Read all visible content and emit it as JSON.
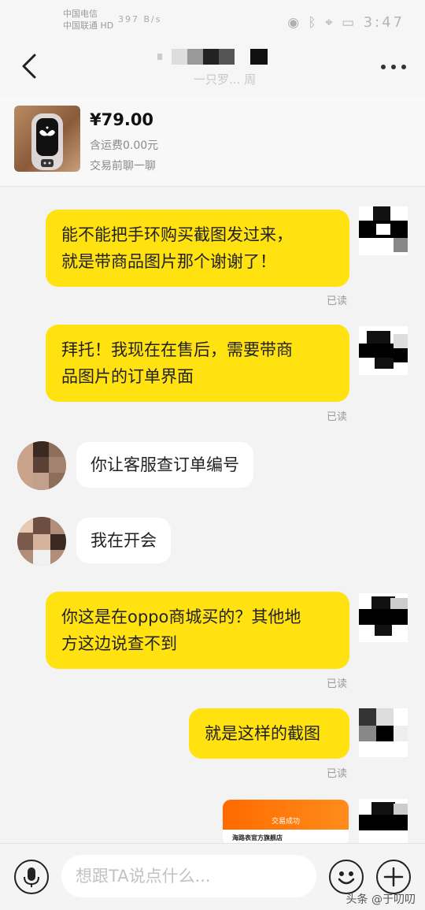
{
  "status_bar": {
    "carrier_line1": "中国电信",
    "carrier_line2": "中国联通 HD",
    "network": "397 B/s",
    "time": "3:47"
  },
  "nav": {
    "back_icon": "chevron-left-icon",
    "title": "",
    "subtitle": "一只罗... 周",
    "more_icon": "more-dots-icon"
  },
  "product": {
    "price": "¥79.00",
    "shipping": "含运费0.00元",
    "note": "交易前聊一聊"
  },
  "messages": [
    {
      "side": "out",
      "lines": [
        "能不能把手环购买截图发过来，",
        "就是带商品图片那个谢谢了！"
      ],
      "status": "已读"
    },
    {
      "side": "out",
      "lines": [
        "拜托！我现在在售后，需要带商",
        "品图片的订单界面"
      ],
      "status": "已读"
    },
    {
      "side": "in",
      "lines": [
        "你让客服查订单编号"
      ]
    },
    {
      "side": "in",
      "lines": [
        "我在开会"
      ]
    },
    {
      "side": "out",
      "lines": [
        "你这是在oppo商城买的？其他地",
        "方这边说查不到"
      ],
      "status": "已读"
    },
    {
      "side": "out",
      "lines": [
        "就是这样的截图"
      ],
      "status": "已读"
    }
  ],
  "image_message": {
    "header_title": "交易成功",
    "shop_name": "海路表官方旗舰店"
  },
  "input": {
    "placeholder": "想跟TA说点什么...",
    "voice_icon": "microphone-icon",
    "emoji_icon": "emoji-icon",
    "add_icon": "plus-icon"
  },
  "watermark": "头条 @于叨叨",
  "colors": {
    "bubble_out": "#ffe210",
    "bubble_in": "#ffffff",
    "background": "#f3f3f3"
  }
}
